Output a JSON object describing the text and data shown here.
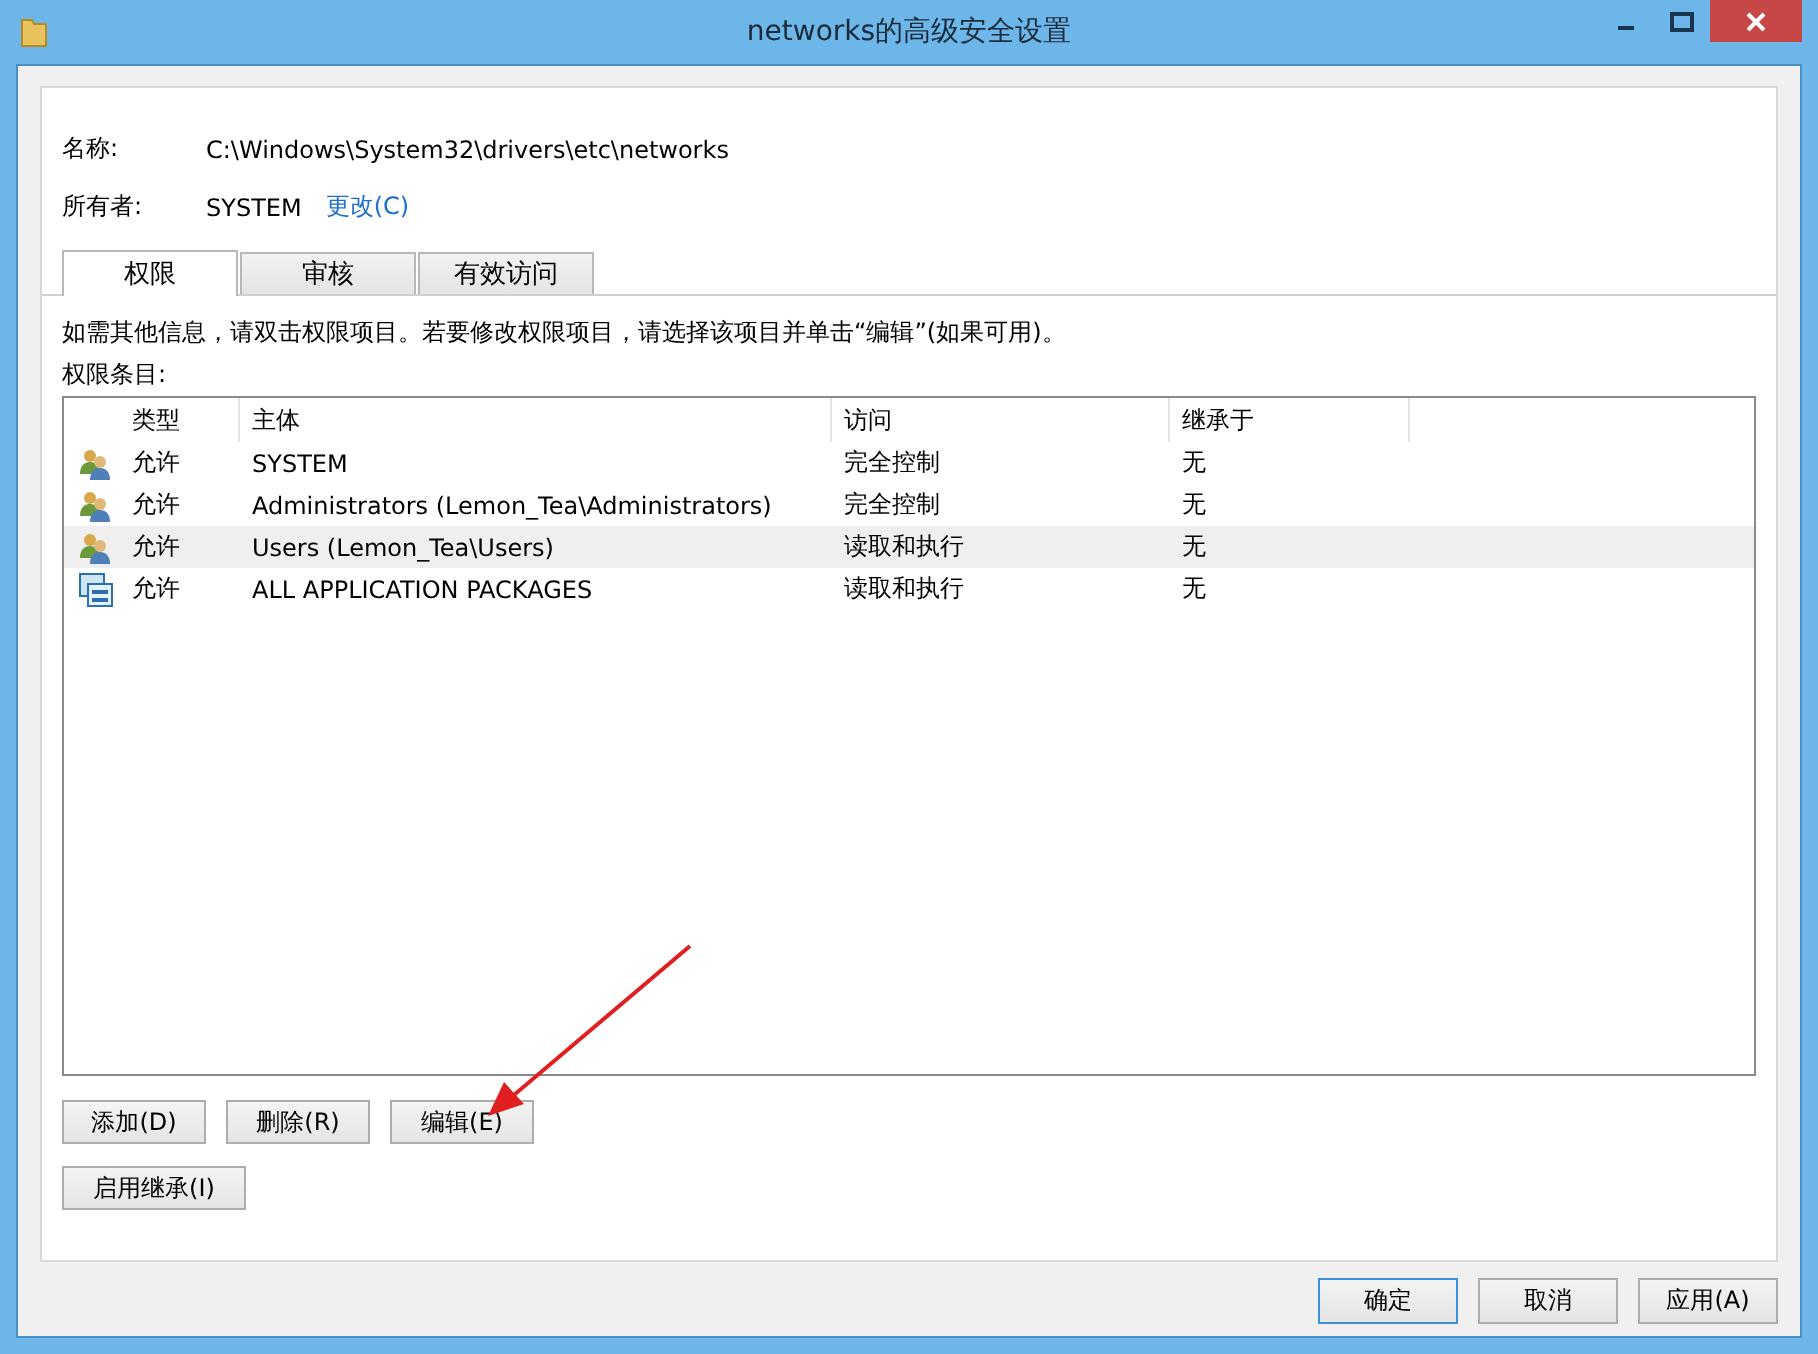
{
  "window": {
    "title": "networks的高级安全设置"
  },
  "name": {
    "label": "名称:",
    "value": "C:\\Windows\\System32\\drivers\\etc\\networks"
  },
  "owner": {
    "label": "所有者:",
    "value": "SYSTEM",
    "link": "更改(C)"
  },
  "tabs": [
    {
      "label": "权限",
      "selected": true
    },
    {
      "label": "审核",
      "selected": false
    },
    {
      "label": "有效访问",
      "selected": false
    }
  ],
  "info": "如需其他信息，请双击权限项目。若要修改权限项目，请选择该项目并单击“编辑”(如果可用)。",
  "list_label": "权限条目:",
  "table": {
    "columns": [
      "类型",
      "主体",
      "访问",
      "继承于"
    ],
    "rows": [
      {
        "kind": "users",
        "type": "允许",
        "principal": "SYSTEM",
        "access": "完全控制",
        "inherited": "无",
        "selected": false
      },
      {
        "kind": "users",
        "type": "允许",
        "principal": "Administrators (Lemon_Tea\\Administrators)",
        "access": "完全控制",
        "inherited": "无",
        "selected": false
      },
      {
        "kind": "users",
        "type": "允许",
        "principal": "Users (Lemon_Tea\\Users)",
        "access": "读取和执行",
        "inherited": "无",
        "selected": true
      },
      {
        "kind": "package",
        "type": "允许",
        "principal": "ALL APPLICATION PACKAGES",
        "access": "读取和执行",
        "inherited": "无",
        "selected": false
      }
    ]
  },
  "entry_buttons": [
    "添加(D)",
    "删除(R)",
    "编辑(E)"
  ],
  "inherit_button": "启用继承(I)",
  "dialog_buttons": [
    {
      "label": "确定",
      "default": true
    },
    {
      "label": "取消",
      "default": false
    },
    {
      "label": "应用(A)",
      "default": false
    }
  ]
}
